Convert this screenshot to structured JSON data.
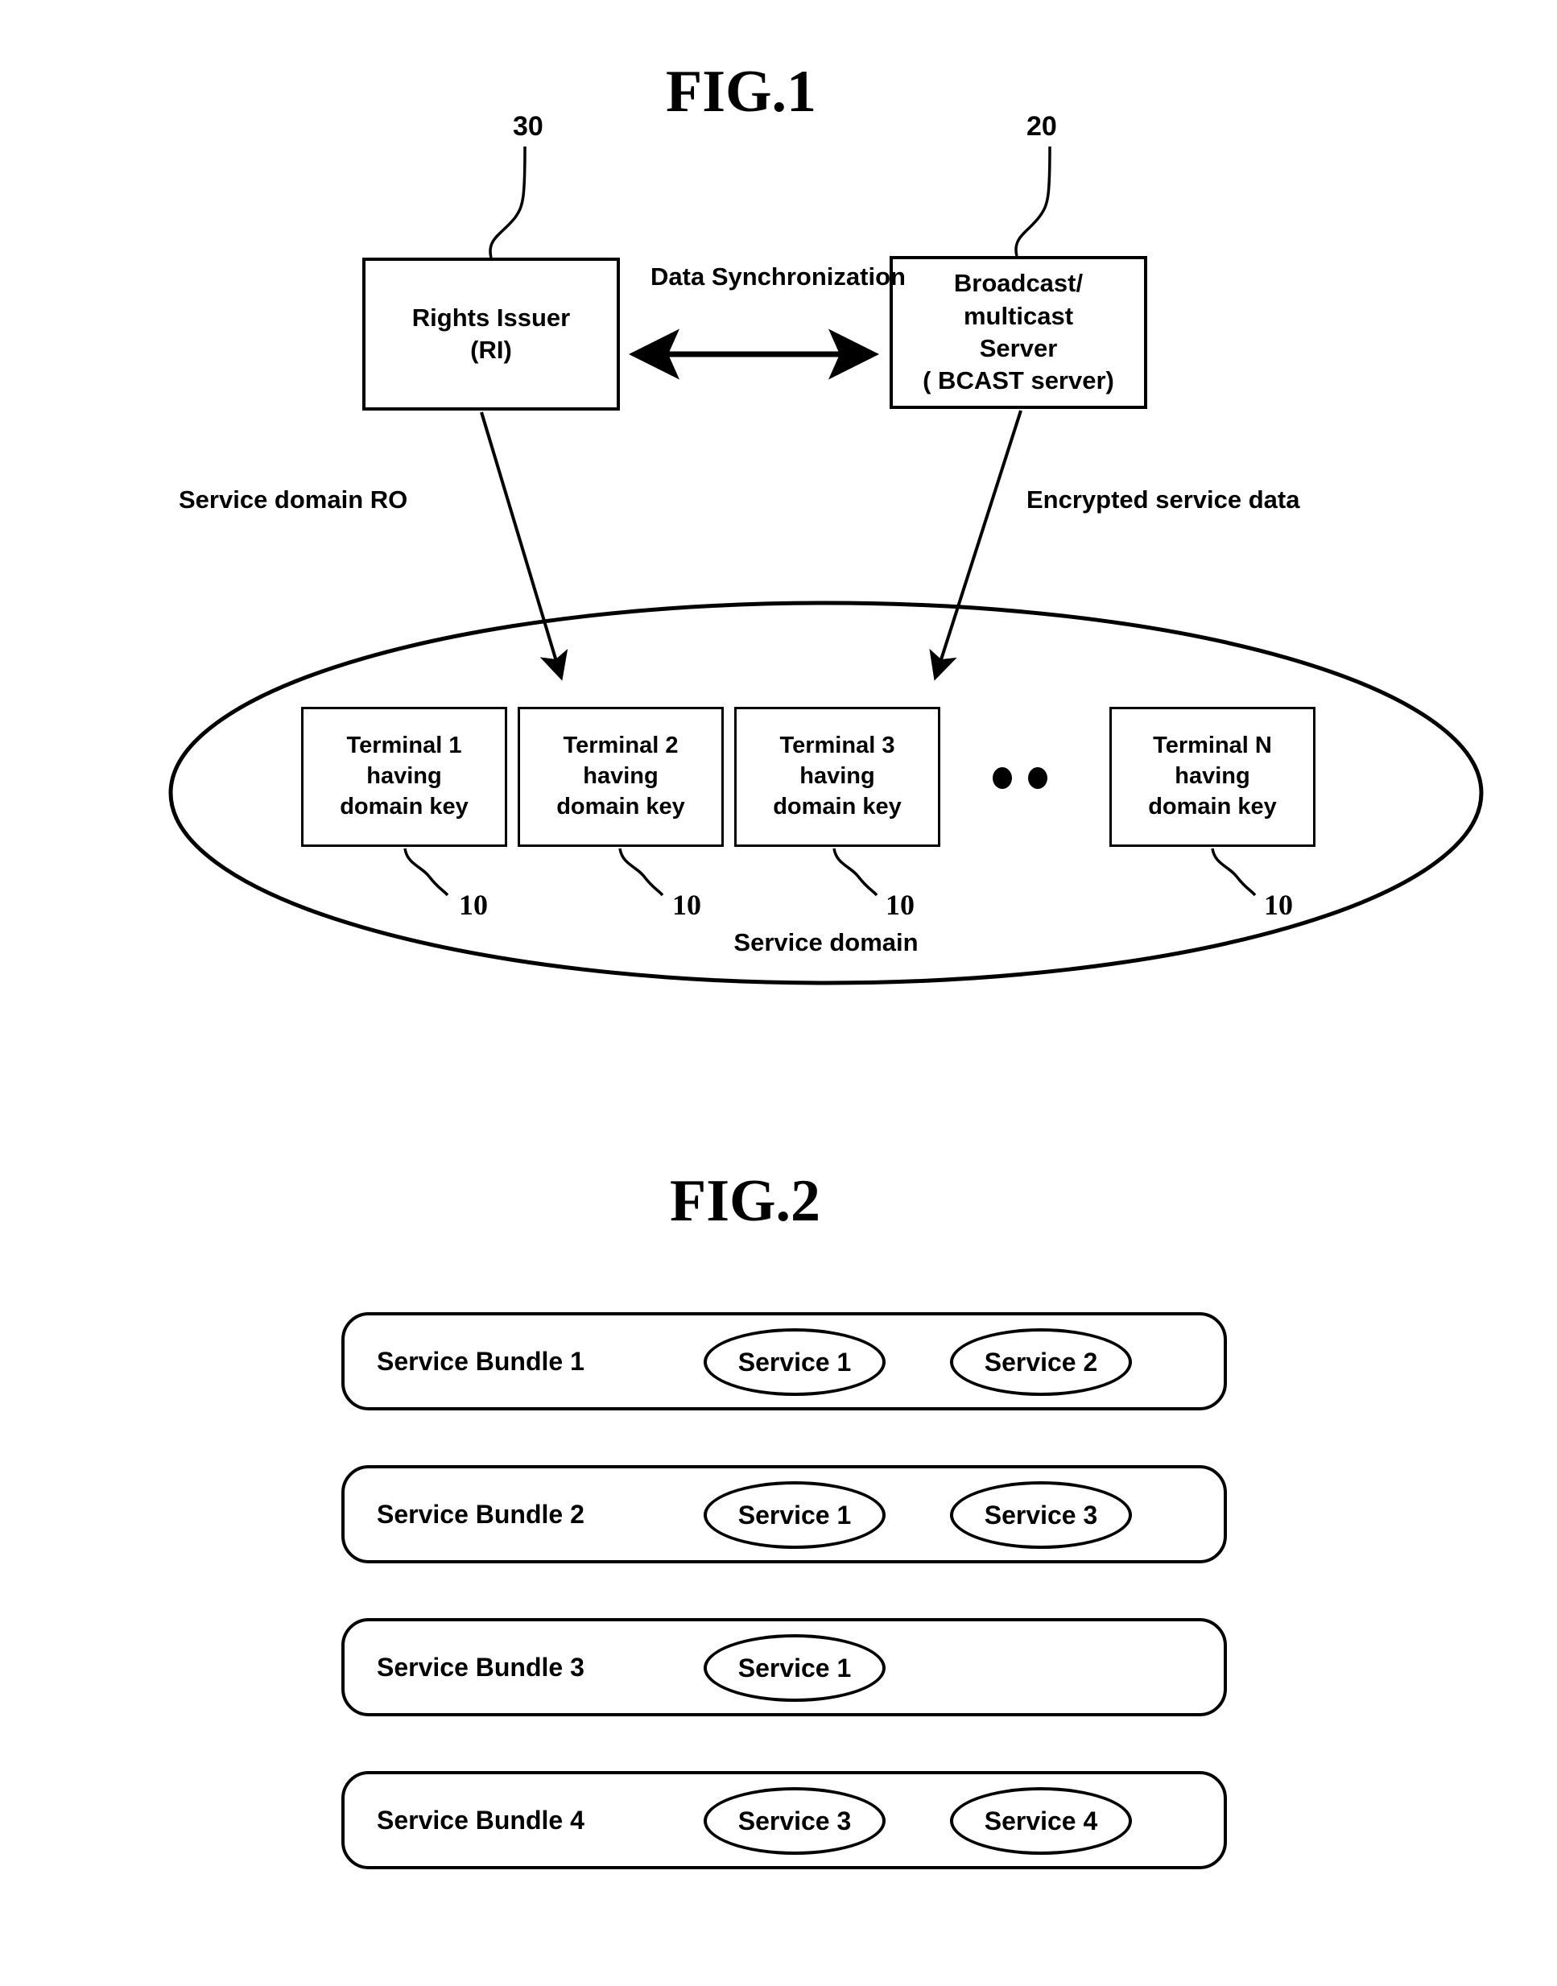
{
  "figures": [
    {
      "title": "FIG.1",
      "nodes": {
        "rights_issuer": {
          "ref": "30",
          "lines": [
            "Rights Issuer",
            "(RI)"
          ]
        },
        "bcast_server": {
          "ref": "20",
          "lines": [
            "Broadcast/",
            "multicast",
            "Server",
            "( BCAST server)"
          ]
        }
      },
      "links": {
        "data_sync": [
          "Data",
          "Synchronization"
        ],
        "service_domain_ro": "Service domain RO",
        "encrypted_service_data": "Encrypted service data"
      },
      "domain": {
        "label": "Service domain",
        "terminals": [
          {
            "ref": "10",
            "lines": [
              "Terminal 1",
              "having",
              "domain key"
            ]
          },
          {
            "ref": "10",
            "lines": [
              "Terminal 2",
              "having",
              "domain key"
            ]
          },
          {
            "ref": "10",
            "lines": [
              "Terminal 3",
              "having",
              "domain key"
            ]
          },
          {
            "ref": "10",
            "lines": [
              "Terminal N",
              "having",
              "domain key"
            ]
          }
        ],
        "ellipsis": "● ●"
      }
    },
    {
      "title": "FIG.2",
      "bundles": [
        {
          "label": "Service Bundle 1",
          "services": [
            "Service 1",
            "Service 2"
          ]
        },
        {
          "label": "Service Bundle 2",
          "services": [
            "Service 1",
            "Service 3"
          ]
        },
        {
          "label": "Service Bundle 3",
          "services": [
            "Service 1"
          ]
        },
        {
          "label": "Service Bundle 4",
          "services": [
            "Service 3",
            "Service 4"
          ]
        }
      ]
    }
  ]
}
